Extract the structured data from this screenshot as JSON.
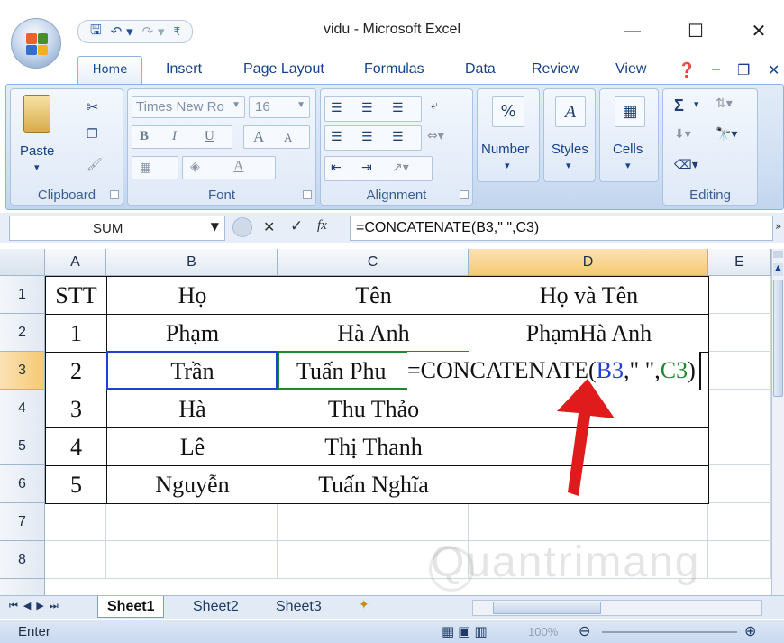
{
  "window": {
    "title": "vidu - Microsoft Excel",
    "min_label": "—",
    "max_label": "☐",
    "close_label": "✕"
  },
  "qat": {
    "save": "🖫",
    "undo": "↶ ▾",
    "redo": "↷ ▾",
    "customize": "₹"
  },
  "tabs": [
    "Home",
    "Insert",
    "Page Layout",
    "Formulas",
    "Data",
    "Review",
    "View"
  ],
  "tab_controls": {
    "help": "❓",
    "minimize": "–",
    "restore": "❐",
    "close": "✕"
  },
  "ribbon": {
    "clipboard": {
      "label": "Clipboard",
      "paste": "Paste"
    },
    "font": {
      "label": "Font",
      "name": "Times New Ro",
      "size": "16",
      "bold": "B",
      "italic": "I",
      "underline": "U",
      "grow": "A",
      "shrink": "A"
    },
    "alignment": {
      "label": "Alignment"
    },
    "number": {
      "label": "Number",
      "icon": "%"
    },
    "styles": {
      "label": "Styles",
      "icon": "A"
    },
    "cells": {
      "label": "Cells"
    },
    "editing": {
      "label": "Editing",
      "sum": "Σ"
    }
  },
  "formula_bar": {
    "name_box": "SUM",
    "cancel": "✕",
    "enter": "✓",
    "fx": "fx",
    "formula": "=CONCATENATE(B3,\" \",C3)"
  },
  "columns": [
    "A",
    "B",
    "C",
    "D",
    "E"
  ],
  "rows": [
    "1",
    "2",
    "3",
    "4",
    "5",
    "6",
    "7",
    "8"
  ],
  "cells": {
    "r1": [
      "STT",
      "Họ",
      "Tên",
      "Họ và Tên"
    ],
    "r2": [
      "1",
      "Phạm",
      "Hà Anh",
      "PhạmHà Anh"
    ],
    "r3": [
      "2",
      "Trần",
      "Tuấn Phu",
      ""
    ],
    "r4": [
      "3",
      "Hà",
      "Thu Thảo",
      ""
    ],
    "r5": [
      "4",
      "Lê",
      "Thị Thanh",
      ""
    ],
    "r6": [
      "5",
      "Nguyễn",
      "Tuấn Nghĩa",
      ""
    ]
  },
  "edit_formula": {
    "prefix": "=CONCATENATE(",
    "ref1": "B3",
    "mid": ",\" \",",
    "ref2": "C3",
    "suffix": ")"
  },
  "sheets": [
    "Sheet1",
    "Sheet2",
    "Sheet3"
  ],
  "status": {
    "mode": "Enter",
    "zoom": "100%"
  },
  "watermark": "Quantrimang",
  "colors": {
    "ref1": "#1f3fd6",
    "ref2": "#1e8a2e",
    "arrow": "#e01b1b",
    "selected_header": "#f6c972"
  }
}
